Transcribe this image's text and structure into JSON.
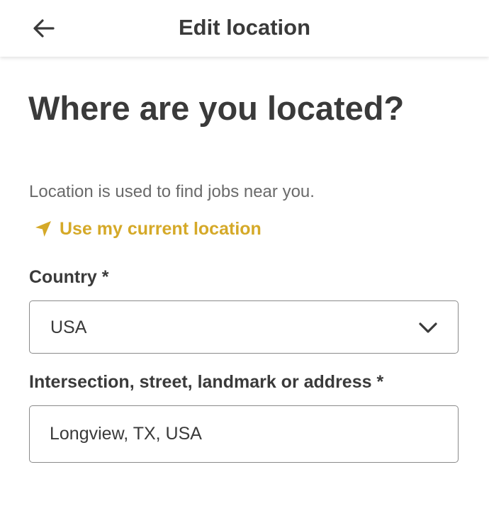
{
  "header": {
    "back_icon": "arrow-left-icon",
    "title": "Edit location"
  },
  "main": {
    "heading": "Where are you located?",
    "helper_text": "Location is used to find jobs near you.",
    "use_location": {
      "icon": "navigation-arrow-icon",
      "label": "Use my current location"
    },
    "country": {
      "label": "Country *",
      "selected": "USA",
      "chevron_icon": "chevron-down-icon"
    },
    "address": {
      "label": "Intersection, street, landmark or address *",
      "value": "Longview, TX, USA"
    }
  },
  "colors": {
    "accent": "#d5a928",
    "text": "#3a3a3a",
    "muted": "#6a6a6a",
    "border": "#8a8a8a"
  }
}
